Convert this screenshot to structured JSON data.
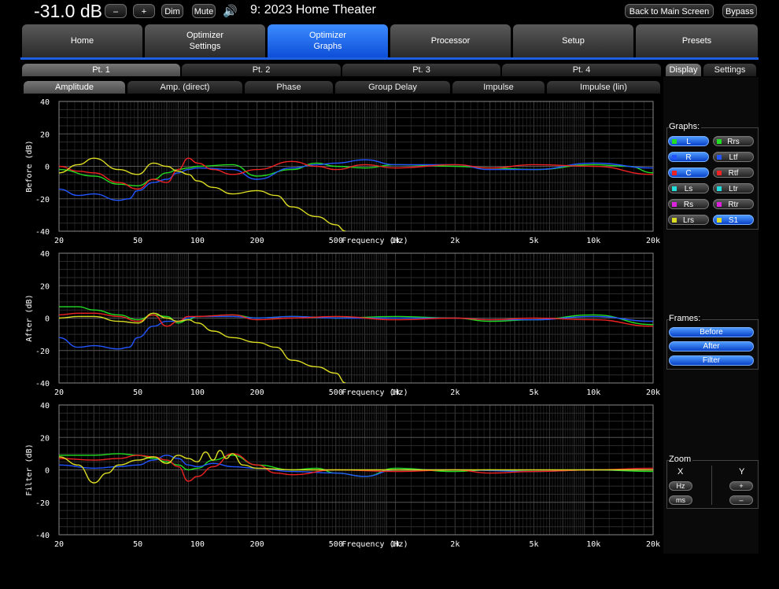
{
  "header": {
    "volume": "-31.0 dB",
    "minus_label": "–",
    "plus_label": "+",
    "dim_label": "Dim",
    "mute_label": "Mute",
    "speaker_glyph": "🔊",
    "title": "9: 2023 Home Theater",
    "back_label": "Back to Main Screen",
    "bypass_label": "Bypass"
  },
  "nav": [
    "Home",
    "Optimizer\nSettings",
    "Optimizer\nGraphs",
    "Processor",
    "Setup",
    "Presets"
  ],
  "points": [
    "Pt. 1",
    "Pt. 2",
    "Pt. 3",
    "Pt. 4"
  ],
  "right_tabs": [
    "Display",
    "Settings"
  ],
  "graph_tabs": [
    "Amplitude",
    "Amp. (direct)",
    "Phase",
    "Group Delay",
    "Impulse",
    "Impulse (lin)"
  ],
  "side": {
    "graphs_label": "Graphs:",
    "channels": [
      {
        "label": "L",
        "color": "#22dd22",
        "on": true
      },
      {
        "label": "Rrs",
        "color": "#22dd22",
        "on": false
      },
      {
        "label": "R",
        "color": "#2255ff",
        "on": true
      },
      {
        "label": "Ltf",
        "color": "#2255ff",
        "on": false
      },
      {
        "label": "C",
        "color": "#ee2222",
        "on": true
      },
      {
        "label": "Rtf",
        "color": "#ee2222",
        "on": false
      },
      {
        "label": "Ls",
        "color": "#22dddd",
        "on": false
      },
      {
        "label": "Ltr",
        "color": "#22dddd",
        "on": false
      },
      {
        "label": "Rs",
        "color": "#dd22dd",
        "on": false
      },
      {
        "label": "Rtr",
        "color": "#dd22dd",
        "on": false
      },
      {
        "label": "Lrs",
        "color": "#dddd22",
        "on": false
      },
      {
        "label": "S1",
        "color": "#dddd22",
        "on": true
      }
    ],
    "frames_label": "Frames:",
    "frames": [
      "Before",
      "After",
      "Filter"
    ],
    "zoom_label": "Zoom",
    "zoom_x": "X",
    "zoom_y": "Y",
    "zoom_hz": "Hz",
    "zoom_ms": "ms",
    "zoom_plus": "+",
    "zoom_minus": "–"
  },
  "chart_data": [
    {
      "type": "line",
      "ylabel": "Before (dB)",
      "xlabel": "Frequency (Hz)",
      "x_scale": "log",
      "xlim": [
        20,
        20000
      ],
      "ylim": [
        -40,
        40
      ],
      "x_ticks": [
        "20",
        "50",
        "100",
        "200",
        "500",
        "1k",
        "2k",
        "5k",
        "10k",
        "20k"
      ],
      "y_ticks": [
        "40",
        "20",
        "0",
        "-20",
        "-40"
      ],
      "grid": true,
      "series": [
        {
          "name": "L",
          "color": "#22dd22",
          "x": [
            20,
            30,
            40,
            50,
            60,
            70,
            80,
            90,
            100,
            150,
            200,
            300,
            400,
            500,
            700,
            1000,
            2000,
            3000,
            5000,
            10000,
            15000,
            20000
          ],
          "y": [
            -2,
            -6,
            -11,
            -12,
            -8,
            -4,
            -2,
            -1,
            0,
            1,
            -6,
            -2,
            2,
            0,
            -1,
            1,
            0,
            -1,
            -2,
            1,
            0,
            -4
          ]
        },
        {
          "name": "R",
          "color": "#2255ff",
          "x": [
            20,
            25,
            30,
            40,
            45,
            50,
            60,
            70,
            80,
            90,
            100,
            150,
            200,
            300,
            400,
            500,
            700,
            1000,
            2000,
            3000,
            5000,
            10000,
            20000
          ],
          "y": [
            -14,
            -18,
            -17,
            -21,
            -20,
            -15,
            -10,
            -8,
            -4,
            -2,
            -1,
            -2,
            -8,
            -1,
            1,
            2,
            4,
            1,
            1,
            -2,
            -2,
            2,
            -1
          ]
        },
        {
          "name": "C",
          "color": "#ee2222",
          "x": [
            20,
            25,
            30,
            40,
            50,
            60,
            70,
            80,
            90,
            100,
            120,
            150,
            200,
            300,
            400,
            500,
            700,
            1000,
            2000,
            3000,
            5000,
            10000,
            20000
          ],
          "y": [
            0,
            -3,
            -4,
            -10,
            -14,
            -8,
            -10,
            -2,
            5,
            2,
            -2,
            -5,
            -2,
            3,
            0,
            -2,
            1,
            -1,
            1,
            -1,
            1,
            0,
            -5
          ]
        },
        {
          "name": "S1",
          "color": "#dddd22",
          "x": [
            20,
            25,
            30,
            40,
            50,
            60,
            70,
            80,
            90,
            100,
            120,
            150,
            200,
            250,
            300,
            400,
            500,
            560
          ],
          "y": [
            -4,
            1,
            5,
            -2,
            -5,
            2,
            0,
            -3,
            -5,
            -9,
            -13,
            -17,
            -15,
            -18,
            -25,
            -31,
            -36,
            -40
          ]
        }
      ]
    },
    {
      "type": "line",
      "ylabel": "After (dB)",
      "xlabel": "Frequency (Hz)",
      "x_scale": "log",
      "xlim": [
        20,
        20000
      ],
      "ylim": [
        -40,
        40
      ],
      "x_ticks": [
        "20",
        "50",
        "100",
        "200",
        "500",
        "1k",
        "2k",
        "5k",
        "10k",
        "20k"
      ],
      "y_ticks": [
        "40",
        "20",
        "0",
        "-20",
        "-40"
      ],
      "grid": true,
      "series": [
        {
          "name": "L",
          "color": "#22dd22",
          "x": [
            20,
            25,
            30,
            40,
            50,
            60,
            70,
            80,
            90,
            100,
            150,
            200,
            300,
            500,
            1000,
            2000,
            3000,
            5000,
            10000,
            20000
          ],
          "y": [
            7,
            7,
            5,
            2,
            -1,
            2,
            1,
            -3,
            -1,
            1,
            2,
            0,
            1,
            0,
            1,
            0,
            -2,
            -1,
            2,
            -4
          ]
        },
        {
          "name": "R",
          "color": "#2255ff",
          "x": [
            20,
            25,
            30,
            40,
            45,
            50,
            60,
            70,
            80,
            90,
            100,
            150,
            200,
            300,
            500,
            1000,
            2000,
            3000,
            5000,
            10000,
            20000
          ],
          "y": [
            -12,
            -18,
            -17,
            -19,
            -18,
            -12,
            -5,
            -2,
            -2,
            0,
            1,
            1,
            0,
            1,
            0,
            0,
            0,
            -1,
            -1,
            1,
            -2
          ]
        },
        {
          "name": "C",
          "color": "#ee2222",
          "x": [
            20,
            25,
            30,
            40,
            50,
            60,
            70,
            80,
            90,
            100,
            150,
            200,
            300,
            500,
            1000,
            2000,
            3000,
            5000,
            10000,
            20000
          ],
          "y": [
            2,
            3,
            3,
            1,
            -2,
            2,
            -5,
            -2,
            1,
            1,
            2,
            -1,
            0,
            1,
            -1,
            0,
            -1,
            0,
            -1,
            -5
          ]
        },
        {
          "name": "S1",
          "color": "#dddd22",
          "x": [
            20,
            25,
            30,
            40,
            50,
            60,
            70,
            80,
            90,
            100,
            120,
            150,
            200,
            250,
            300,
            400,
            500,
            560
          ],
          "y": [
            0,
            1,
            1,
            -2,
            -3,
            3,
            0,
            -2,
            -1,
            -3,
            -8,
            -12,
            -15,
            -18,
            -26,
            -30,
            -34,
            -40
          ]
        }
      ]
    },
    {
      "type": "line",
      "ylabel": "Filter (dB)",
      "xlabel": "Frequency (Hz)",
      "x_scale": "log",
      "xlim": [
        20,
        20000
      ],
      "ylim": [
        -40,
        40
      ],
      "x_ticks": [
        "20",
        "50",
        "100",
        "200",
        "500",
        "1k",
        "2k",
        "5k",
        "10k",
        "20k"
      ],
      "y_ticks": [
        "40",
        "20",
        "0",
        "-20",
        "-40"
      ],
      "grid": true,
      "series": [
        {
          "name": "L",
          "color": "#22dd22",
          "x": [
            20,
            30,
            40,
            50,
            60,
            70,
            80,
            90,
            100,
            120,
            150,
            200,
            300,
            400,
            500,
            700,
            1000,
            2000,
            3000,
            5000,
            10000,
            20000
          ],
          "y": [
            9,
            9,
            10,
            9,
            7,
            5,
            3,
            0,
            1,
            6,
            9,
            3,
            0,
            1,
            -2,
            -4,
            1,
            -1,
            0,
            -1,
            0,
            -1
          ]
        },
        {
          "name": "R",
          "color": "#2255ff",
          "x": [
            20,
            30,
            40,
            50,
            60,
            70,
            80,
            90,
            100,
            120,
            150,
            200,
            300,
            500,
            700,
            1000,
            2000,
            5000,
            10000,
            20000
          ],
          "y": [
            3,
            1,
            2,
            3,
            6,
            9,
            7,
            3,
            2,
            4,
            2,
            1,
            -1,
            -2,
            -4,
            0,
            0,
            -1,
            0,
            0
          ]
        },
        {
          "name": "C",
          "color": "#ee2222",
          "x": [
            20,
            30,
            40,
            50,
            60,
            70,
            80,
            90,
            100,
            120,
            150,
            200,
            250,
            300,
            500,
            1000,
            2000,
            3000,
            5000,
            10000,
            20000
          ],
          "y": [
            7,
            6,
            7,
            9,
            8,
            6,
            2,
            -7,
            -4,
            2,
            10,
            3,
            -2,
            -3,
            0,
            -1,
            0,
            -2,
            -1,
            0,
            1
          ]
        },
        {
          "name": "S1",
          "color": "#dddd22",
          "x": [
            20,
            25,
            30,
            35,
            40,
            50,
            60,
            70,
            80,
            90,
            100,
            110,
            120,
            130,
            140,
            150,
            170,
            200,
            300,
            500,
            1000,
            2000,
            5000,
            10000,
            20000
          ],
          "y": [
            8,
            3,
            -8,
            -2,
            3,
            6,
            8,
            4,
            9,
            7,
            5,
            11,
            6,
            12,
            7,
            10,
            3,
            1,
            0,
            0,
            0,
            0,
            0,
            0,
            0
          ]
        }
      ]
    }
  ]
}
